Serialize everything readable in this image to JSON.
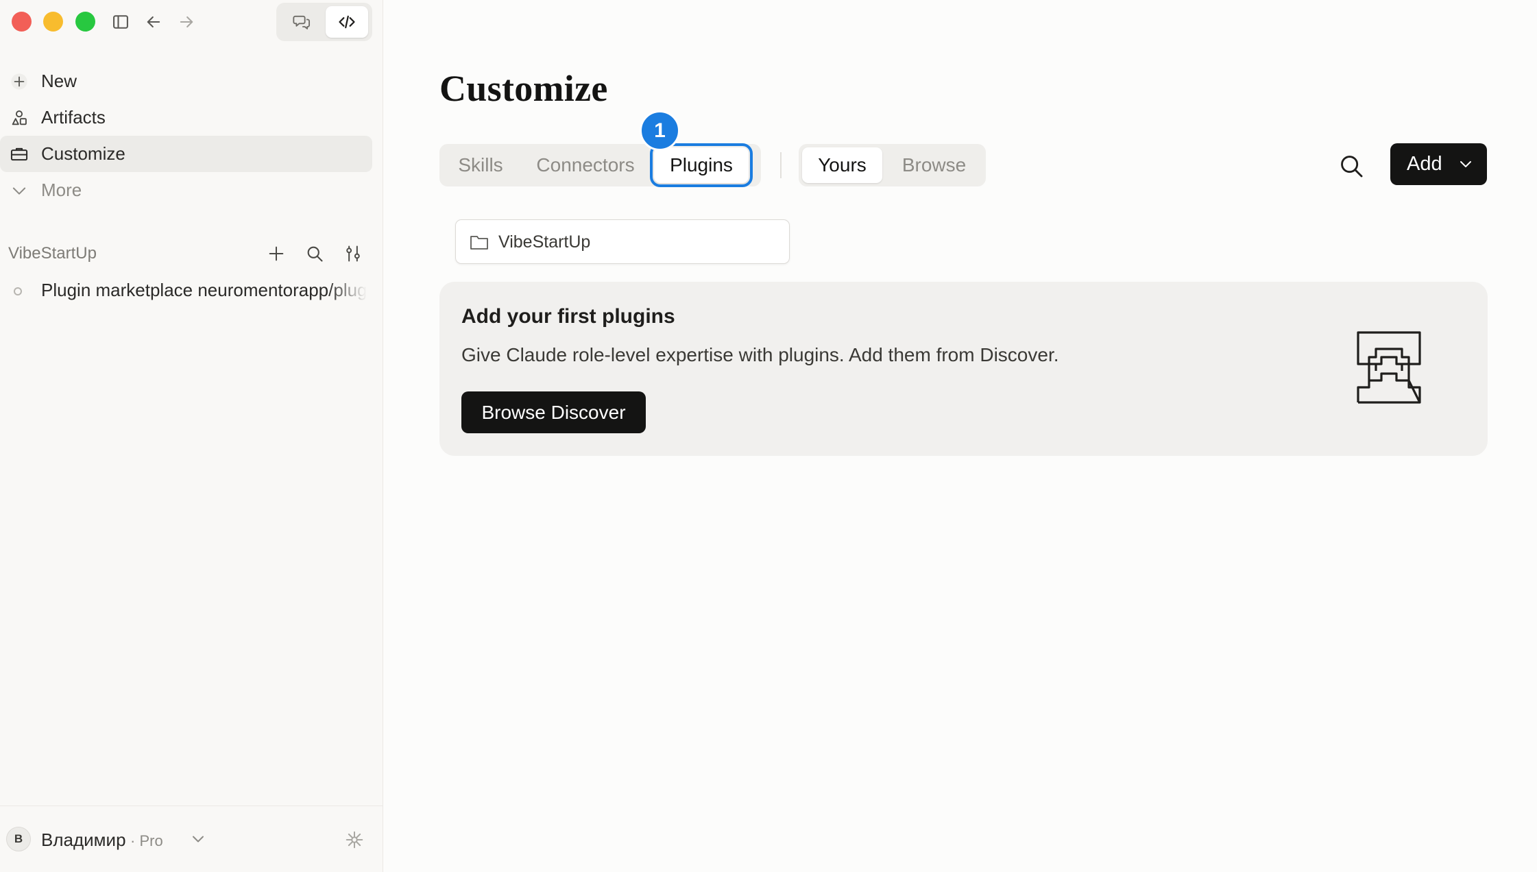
{
  "window": {
    "mode_chat_icon": "chat-bubbles-icon",
    "mode_code_icon": "code-icon"
  },
  "sidebar": {
    "nav": [
      {
        "label": "New",
        "icon": "plus-icon"
      },
      {
        "label": "Artifacts",
        "icon": "shapes-icon"
      },
      {
        "label": "Customize",
        "icon": "briefcase-icon",
        "active": true
      },
      {
        "label": "More",
        "icon": "chevron-down-icon"
      }
    ],
    "project": {
      "name": "VibeStartUp",
      "session": "Plugin marketplace neuromentorapp/plugins"
    },
    "user": {
      "initial": "В",
      "name": "Владимир",
      "plan": "· Pro"
    }
  },
  "main": {
    "title": "Customize",
    "tabs": [
      "Skills",
      "Connectors",
      "Plugins"
    ],
    "selected_tab": "Plugins",
    "scope_tabs": [
      "Yours",
      "Browse"
    ],
    "selected_scope": "Yours",
    "step_badge": "1",
    "add_label": "Add",
    "folder": "VibeStartUp",
    "empty_state": {
      "title": "Add your first plugins",
      "description": "Give Claude role-level expertise with plugins. Add them from Discover.",
      "button": "Browse Discover"
    }
  },
  "colors": {
    "accent": "#1b7de0",
    "primary_button": "#141413",
    "close": "#f25f57",
    "minimize": "#f8bc2e",
    "zoom": "#28c840"
  }
}
